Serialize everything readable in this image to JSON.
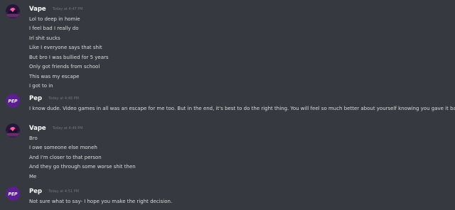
{
  "messages": [
    {
      "author": "Vape",
      "timestamp": "Today at 4:47 PM",
      "avatar_icon": "vape-avatar",
      "lines": [
        "Lol to deep in homie",
        "I feel bad I really do",
        "Irl shit sucks",
        "Like I everyone says that shit",
        "But bro I was bullied for 5 years",
        "Only got friends from school",
        "This was my escape",
        "I got to in"
      ]
    },
    {
      "author": "Pep",
      "timestamp": "Today at 4:48 PM",
      "avatar_icon": "pep-avatar",
      "avatar_text": "PEP",
      "lines": [
        "I know dude. Video games in all was an escape for me too. But in the end, it's best to do the right thing. You will feel so much better about yourself knowing you gave it back."
      ]
    },
    {
      "author": "Vape",
      "timestamp": "Today at 4:49 PM",
      "avatar_icon": "vape-avatar",
      "lines": [
        "Bro",
        "I owe someone else moneh",
        "And I'm closer to that person",
        "And they go through some worse shit then",
        "Me"
      ]
    },
    {
      "author": "Pep",
      "timestamp": "Today at 4:51 PM",
      "avatar_icon": "pep-avatar",
      "avatar_text": "PEP",
      "lines": [
        "Not sure what to say- I hope you make the right decision."
      ]
    }
  ],
  "colors": {
    "background": "#36393f",
    "author": "#ffffff",
    "message_text": "#dcddde",
    "timestamp": "#72767d",
    "pep_avatar": "#5c1f8f",
    "vape_avatar_bg": "#27143a",
    "vape_avatar_accent": "#ff5fa2"
  }
}
